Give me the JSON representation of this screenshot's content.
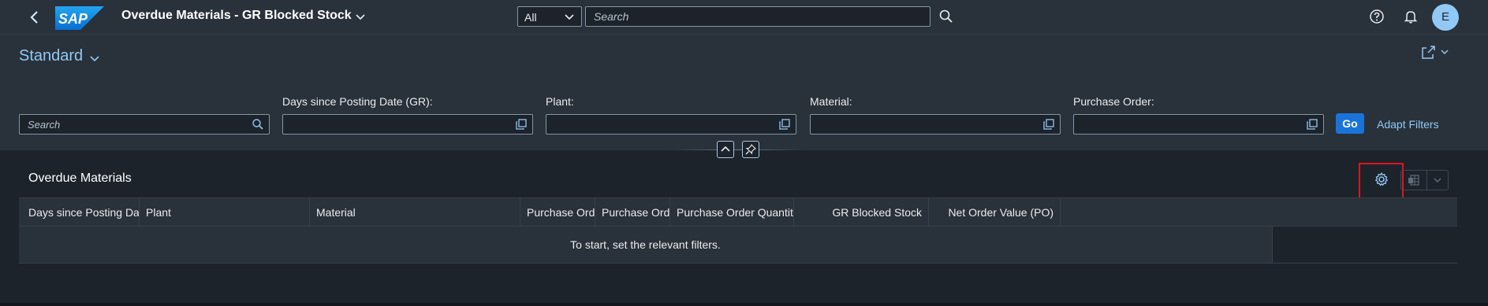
{
  "shell": {
    "logo_text": "SAP",
    "app_title": "Overdue Materials - GR Blocked Stock",
    "scope_value": "All",
    "search_placeholder": "Search",
    "avatar_initial": "E"
  },
  "filterbar": {
    "variant_label": "Standard",
    "search_placeholder": "Search",
    "fields": [
      {
        "label": "Days since Posting Date (GR):"
      },
      {
        "label": "Plant:"
      },
      {
        "label": "Material:"
      },
      {
        "label": "Purchase Order:"
      }
    ],
    "go_label": "Go",
    "adapt_label": "Adapt Filters"
  },
  "table": {
    "title": "Overdue Materials",
    "columns": [
      "Days since Posting Date...",
      "Plant",
      "Material",
      "Purchase Order",
      "Purchase Ord...",
      "Purchase Order Quantity",
      "GR Blocked Stock",
      "Net Order Value (PO)"
    ],
    "no_data_text": "To start, set the relevant filters."
  },
  "colors": {
    "shell_bg": "#29313a",
    "page_bg": "#1d232a",
    "accent": "#91c8f6",
    "button": "#1a73d9",
    "highlight": "#e0141e"
  }
}
